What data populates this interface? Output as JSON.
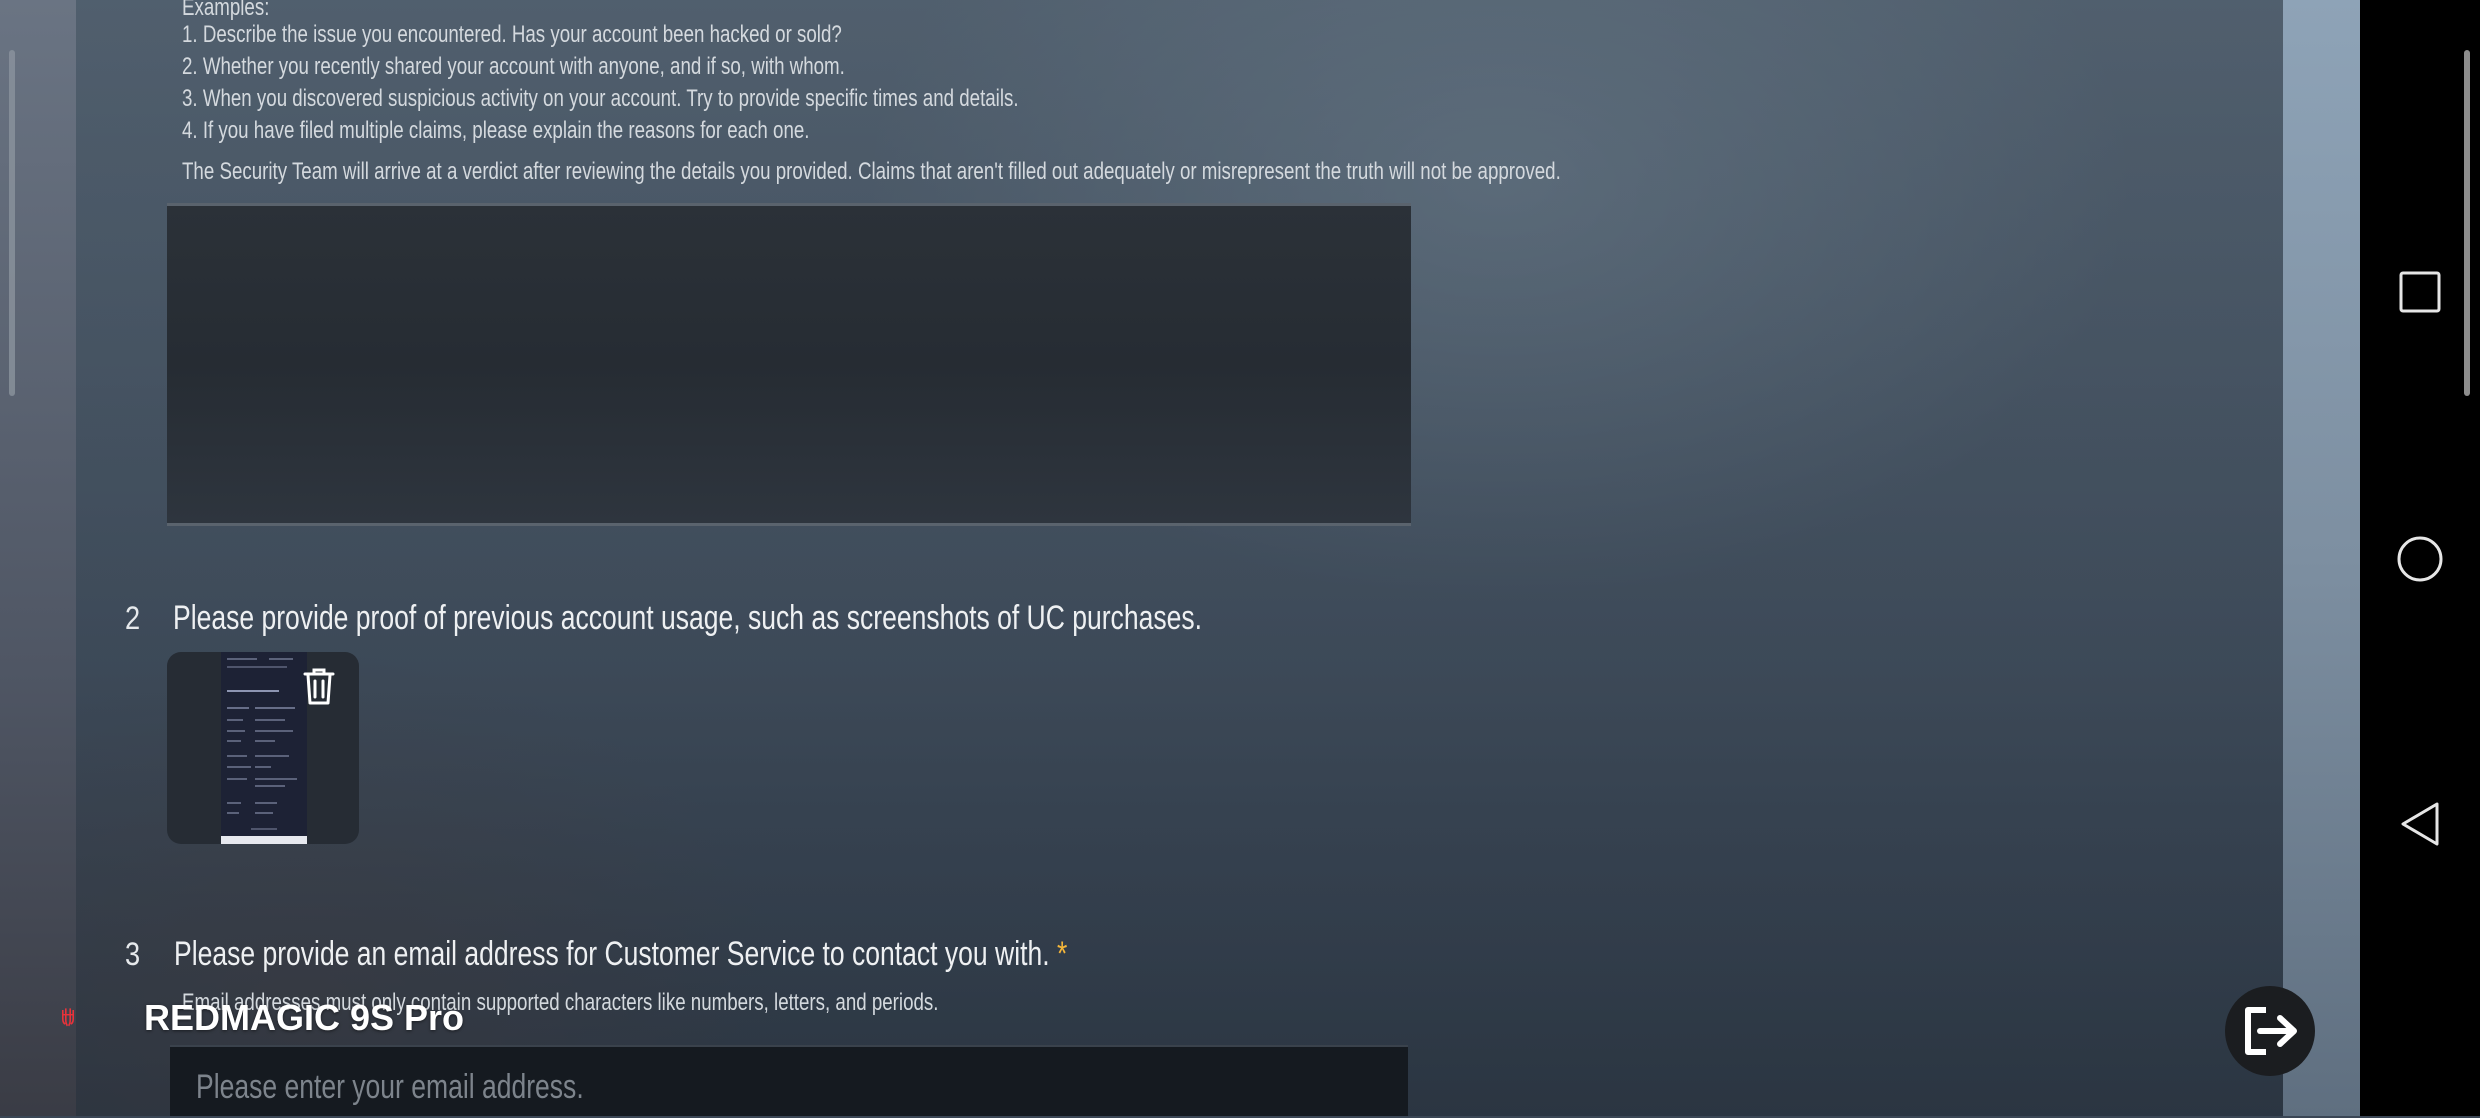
{
  "form": {
    "examples_heading": "Examples:",
    "example_lines": [
      "1. Describe the issue you encountered. Has your account been hacked or sold?",
      "2. Whether you recently shared your account with anyone, and if so, with whom.",
      "3. When you discovered suspicious activity on your account. Try to provide specific times and details.",
      "4. If you have filed multiple claims, please explain the reasons for each one."
    ],
    "verdict_note": "The Security Team will arrive at a verdict after reviewing the details you provided. Claims that aren't filled out adequately or misrepresent the truth will not be approved.",
    "description_value": "",
    "question2": {
      "number": "2",
      "text": "Please provide proof of previous account usage, such as screenshots of UC purchases."
    },
    "question3": {
      "number": "3",
      "text": "Please provide an email address for Customer Service to contact you with.",
      "required_mark": "*",
      "hint": "Email addresses must only contain supported characters like numbers, letters, and periods.",
      "email_placeholder": "Please enter your email address."
    }
  },
  "overlay": {
    "brand_name": "REDMAGIC 9S Pro"
  },
  "colors": {
    "required": "#f5b63a",
    "brand_red": "#e8333b"
  },
  "icons": {
    "delete": "trash-icon",
    "exit": "exit-icon",
    "nav_recents": "square-icon",
    "nav_home": "circle-icon",
    "nav_back": "triangle-back-icon"
  }
}
